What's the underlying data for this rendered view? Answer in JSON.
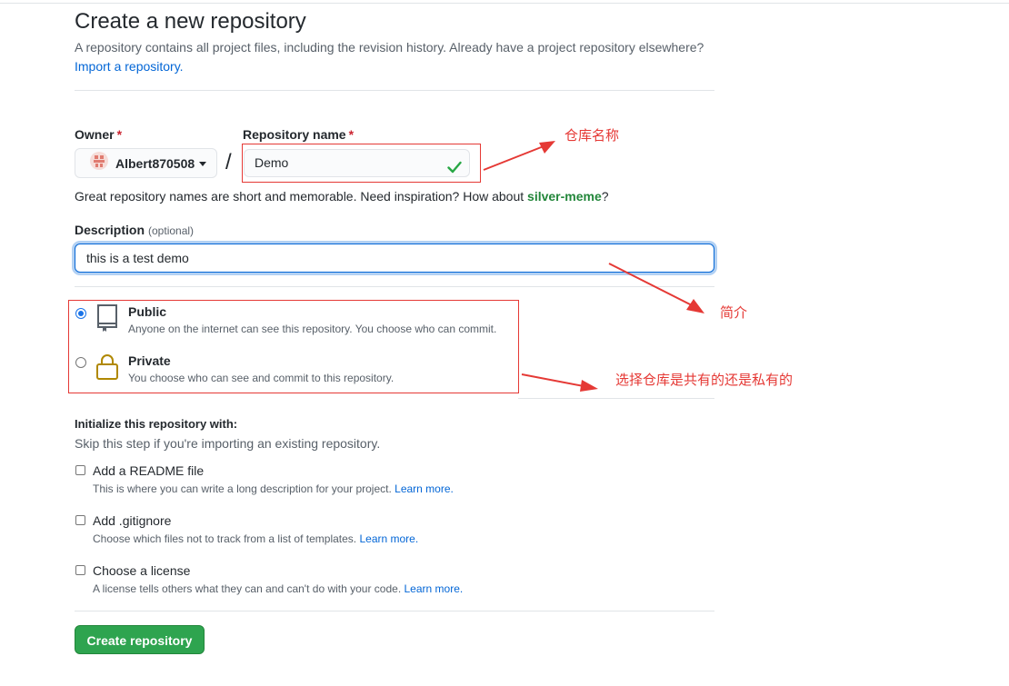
{
  "header": {
    "title": "Create a new repository",
    "subtitle": "A repository contains all project files, including the revision history. Already have a project repository elsewhere?",
    "import_link": "Import a repository."
  },
  "owner": {
    "label": "Owner",
    "required_mark": "*",
    "value": "Albert870508"
  },
  "separator": "/",
  "repo_name": {
    "label": "Repository name",
    "required_mark": "*",
    "value": "Demo"
  },
  "name_hint": {
    "text": "Great repository names are short and memorable. Need inspiration? How about ",
    "suggestion": "silver-meme",
    "suffix": "?"
  },
  "description": {
    "label": "Description",
    "optional": "(optional)",
    "value": "this is a test demo"
  },
  "visibility": {
    "public": {
      "title": "Public",
      "desc": "Anyone on the internet can see this repository. You choose who can commit.",
      "selected": true
    },
    "private": {
      "title": "Private",
      "desc": "You choose who can see and commit to this repository.",
      "selected": false
    }
  },
  "init": {
    "title": "Initialize this repository with:",
    "subtitle": "Skip this step if you're importing an existing repository.",
    "options": [
      {
        "title": "Add a README file",
        "desc": "This is where you can write a long description for your project. ",
        "link": "Learn more.",
        "checked": false
      },
      {
        "title": "Add .gitignore",
        "desc": "Choose which files not to track from a list of templates. ",
        "link": "Learn more.",
        "checked": false
      },
      {
        "title": "Choose a license",
        "desc": "A license tells others what they can and can't do with your code. ",
        "link": "Learn more.",
        "checked": false
      }
    ]
  },
  "create_button": "Create repository",
  "annotations": {
    "repo_name_note": "仓库名称",
    "description_note": "简介",
    "visibility_note": "选择仓库是共有的还是私有的"
  },
  "colors": {
    "accent_blue": "#0366d6",
    "success_green": "#2ea44f",
    "annotation_red": "#e53935",
    "required_red": "#cb2431"
  },
  "icons": {
    "avatar": "identicon-avatar",
    "check": "check-icon",
    "public": "repo-icon",
    "private": "lock-icon"
  }
}
